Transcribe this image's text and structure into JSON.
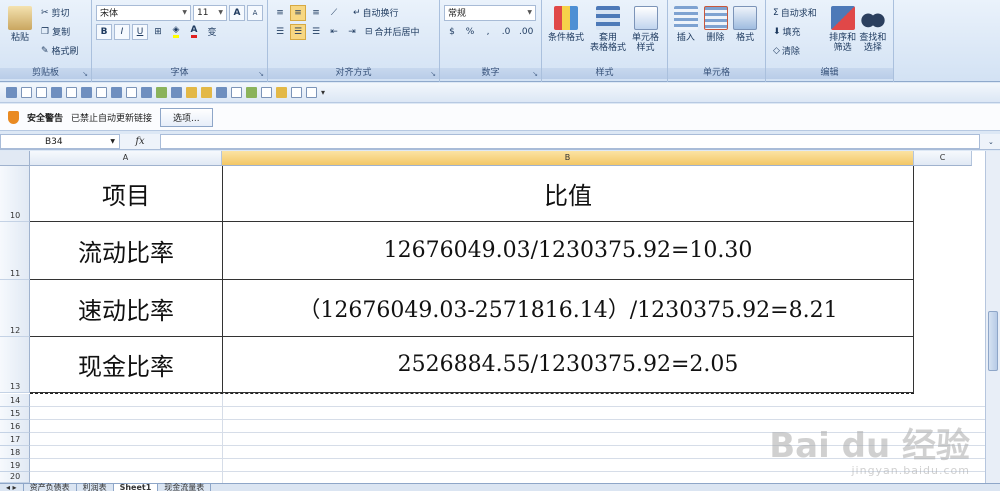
{
  "ribbon": {
    "clipboard": {
      "label": "剪贴板",
      "paste": "粘贴",
      "cut": "剪切",
      "copy": "复制",
      "format_painter": "格式刷"
    },
    "font": {
      "label": "字体",
      "font_name": "宋体",
      "font_size": "11",
      "grow": "A",
      "shrink": "A",
      "bold": "B",
      "italic": "I",
      "underline": "U",
      "font_color": "A",
      "phonetic": "变"
    },
    "alignment": {
      "label": "对齐方式",
      "wrap_text": "自动换行",
      "merge_center": "合并后居中"
    },
    "number": {
      "label": "数字",
      "format": "常规",
      "percent": "%",
      "comma": ",",
      "inc_decimal": ".0",
      "dec_decimal": ".00"
    },
    "styles": {
      "label": "样式",
      "conditional": "条件格式",
      "table_format": "套用\n表格格式",
      "cell_styles": "单元格\n样式"
    },
    "cells": {
      "label": "单元格",
      "insert": "插入",
      "delete": "删除",
      "format": "格式"
    },
    "editing": {
      "label": "编辑",
      "autosum": "自动求和",
      "fill": "填充",
      "clear": "清除",
      "sort_filter": "排序和\n筛选",
      "find_select": "查找和\n选择"
    }
  },
  "security_bar": {
    "title": "安全警告",
    "message": "已禁止自动更新链接",
    "options_button": "选项..."
  },
  "formula_bar": {
    "name_box": "B34",
    "fx": "fx",
    "content": ""
  },
  "columns": [
    {
      "label": "A"
    },
    {
      "label": "B"
    },
    {
      "label": "C"
    }
  ],
  "table": {
    "header": {
      "row": "10",
      "a": "项目",
      "b": "比值"
    },
    "rows": [
      {
        "row": "11",
        "a": "流动比率",
        "b": "12676049.03/1230375.92=10.30"
      },
      {
        "row": "12",
        "a": "速动比率",
        "b": "（12676049.03-2571816.14）/1230375.92=8.21"
      },
      {
        "row": "13",
        "a": "现金比率",
        "b": "2526884.55/1230375.92=2.05"
      }
    ],
    "empty_rows": [
      "14",
      "15",
      "16",
      "17",
      "18",
      "19",
      "20"
    ]
  },
  "sheet_tabs": [
    {
      "label": "资产负债表",
      "active": false
    },
    {
      "label": "利润表",
      "active": false
    },
    {
      "label": "Sheet1",
      "active": true
    },
    {
      "label": "现金流量表",
      "active": false
    }
  ],
  "watermark": {
    "brand": "Bai du 经验",
    "url": "jingyan.baidu.com"
  }
}
